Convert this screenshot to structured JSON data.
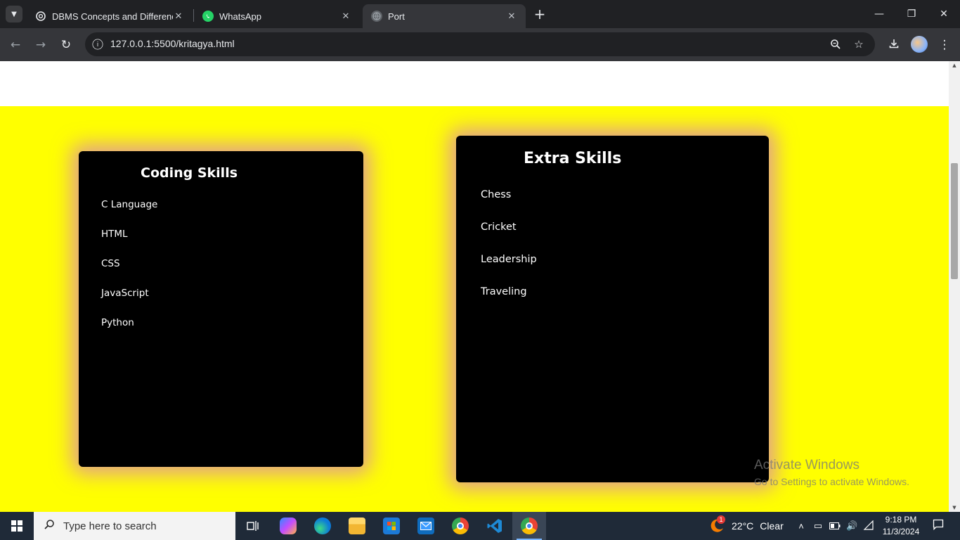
{
  "browser": {
    "tabs": [
      {
        "title": "DBMS Concepts and Difference",
        "favicon": "chatgpt-icon"
      },
      {
        "title": "WhatsApp",
        "favicon": "whatsapp-icon"
      },
      {
        "title": "Port",
        "favicon": "globe-icon",
        "active": true
      }
    ],
    "url": "127.0.0.1:5500/kritagya.html"
  },
  "page": {
    "coding_card": {
      "title": "Coding Skills",
      "items": [
        "C Language",
        "HTML",
        "CSS",
        "JavaScript",
        "Python"
      ]
    },
    "extra_card": {
      "title": "Extra Skills",
      "items": [
        "Chess",
        "Cricket",
        "Leadership",
        "Traveling"
      ]
    },
    "background_color": "#ffff00",
    "glow_color": "#c850ff"
  },
  "watermark": {
    "line1": "Activate Windows",
    "line2": "Go to Settings to activate Windows."
  },
  "taskbar": {
    "search_placeholder": "Type here to search",
    "weather": {
      "temp": "22°C",
      "condition": "Clear",
      "badge": "1"
    },
    "time": "9:18 PM",
    "date": "11/3/2024"
  }
}
